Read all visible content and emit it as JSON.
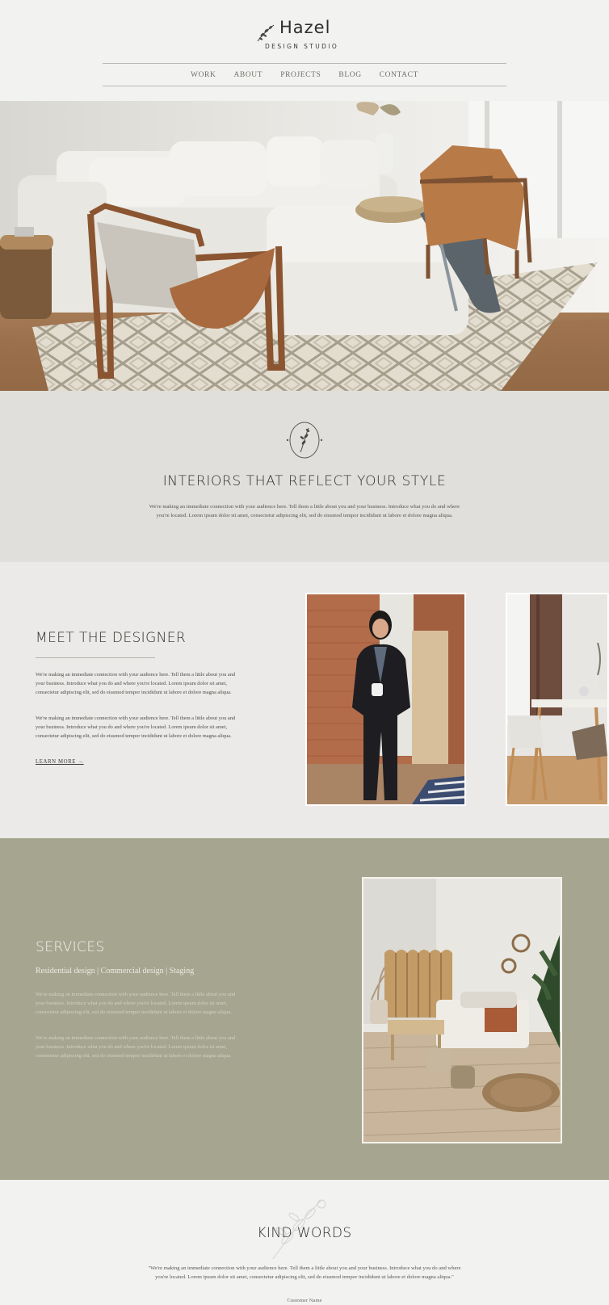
{
  "brand": {
    "name": "Hazel",
    "tagline": "DESIGN STUDIO"
  },
  "nav": {
    "items": [
      "WORK",
      "ABOUT",
      "PROJECTS",
      "BLOG",
      "CONTACT"
    ]
  },
  "intro": {
    "heading": "INTERIORS THAT REFLECT YOUR STYLE",
    "body": "We're making an immediate connection with your audience here. Tell them a little about you and your business. Introduce what you do and where you're located. Lorem ipsum dolor sit amet, consectetur adipiscing elit, sed do eiusmod tempor incididunt ut labore et dolore magna aliqua."
  },
  "designer": {
    "heading": "MEET THE DESIGNER",
    "paragraph_1": "We're making an immediate connection with your audience here. Tell them a little about you and your business. Introduce what you do and where you're located. Lorem ipsum dolor sit amet, consectetur adipiscing elit, sed do eiusmod tempor incididunt ut labore et dolore magna aliqua.",
    "paragraph_2": "We're making an immediate connection with your audience here. Tell them a little about you and your business. Introduce what you do and where you're located. Lorem ipsum dolor sit amet, consectetur adipiscing elit, sed do eiusmod tempor incididunt ut labore et dolore magna aliqua.",
    "link_label": "LEARN MORE →"
  },
  "services": {
    "heading": "SERVICES",
    "list": "Residential design  |  Commercial design  |  Staging",
    "paragraph_1": "We're making an immediate connection with your audience here. Tell them a little about you and your business. Introduce what you do and where you're located. Lorem ipsum dolor sit amet, consectetur adipiscing elit, sed do eiusmod tempor incididunt ut labore et dolore magna aliqua.",
    "paragraph_2": "We're making an immediate connection with your audience here. Tell them a little about you and your business. Introduce what you do and where you're located. Lorem ipsum dolor sit amet, consectetur adipiscing elit, sed do eiusmod tempor incididunt ut labore et dolore magna aliqua."
  },
  "kind_words": {
    "heading": "KIND WORDS",
    "quote": "\"We're making an immediate connection with your audience here. Tell them a little about you and your business. Introduce what you do and where you're located. Lorem ipsum dolor sit amet, consectetur adipiscing elit, sed do eiusmod tempor incididunt ut labore et dolore magna aliqua.\"",
    "cite": "Customer Name"
  },
  "colors": {
    "page_bg": "#f1f1f0",
    "intro_bg": "#e0dfdb",
    "designer_bg": "#ebeae8",
    "services_bg": "#a6a58f",
    "text_dark": "#2b2b28"
  }
}
